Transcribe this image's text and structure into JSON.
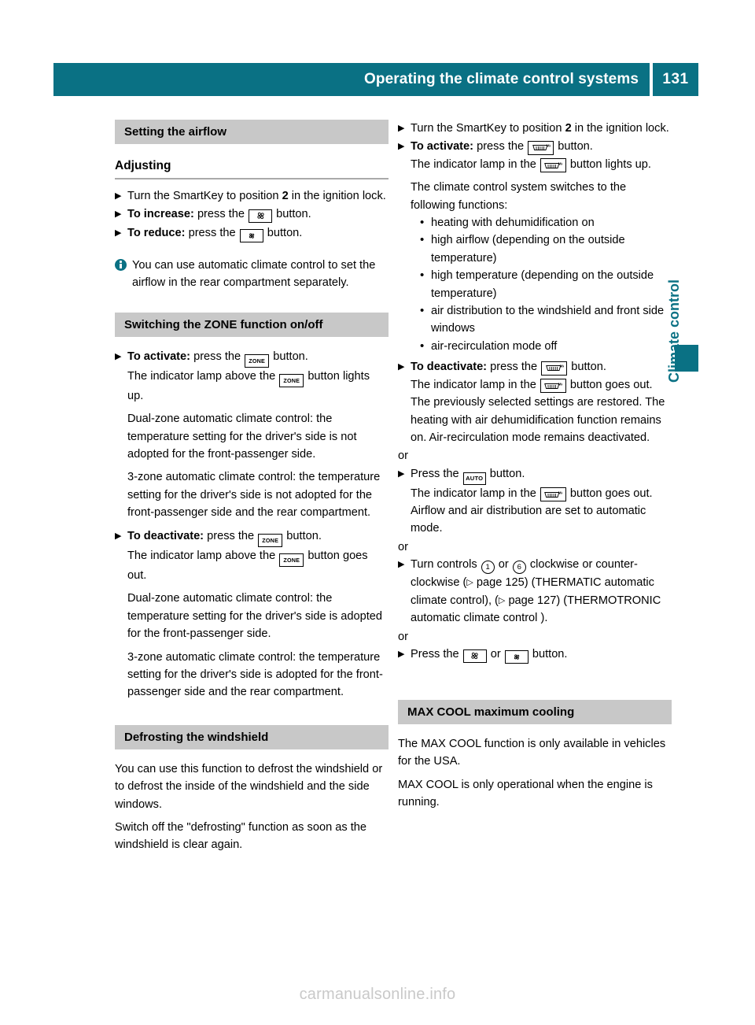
{
  "header": {
    "title": "Operating the climate control systems",
    "page_number": "131",
    "bar_color": "#0a7184"
  },
  "side_tab": {
    "label": "Climate control",
    "color": "#0a7184"
  },
  "watermark": "carmanualsonline.info",
  "icons": {
    "fan_big": "fan-high-icon",
    "fan_small": "fan-low-icon",
    "zone_label": "ZONE",
    "defrost_max_label": "MAX",
    "auto_label": "AUTO",
    "info": "info-icon",
    "ref_arrow": "▷",
    "step_marker": "▶",
    "round_bullet": "•"
  },
  "left_column": {
    "section1": {
      "band": "Setting the airflow",
      "subheading": "Adjusting",
      "steps": [
        {
          "bold": "",
          "text_before": "Turn the SmartKey to position ",
          "bold_inline": "2",
          "text_after": " in the ignition lock."
        },
        {
          "bold": "To increase:",
          "text_before": " press the ",
          "icon": "fan-high-icon",
          "text_after": " button."
        },
        {
          "bold": "To reduce:",
          "text_before": " press the ",
          "icon": "fan-low-icon",
          "text_after": " button."
        }
      ],
      "note": "You can use automatic climate control to set the airflow in the rear compartment separately."
    },
    "section2": {
      "band": "Switching the ZONE function on/off",
      "activate": {
        "bold": "To activate:",
        "text_before": " press the ",
        "icon_label": "ZONE",
        "text_after": " button.",
        "line2_a": "The indicator lamp above the ",
        "line2_b": " button lights up.",
        "para_dual": "Dual-zone automatic climate control: the temperature setting for the driver's side is not adopted for the front-passenger side.",
        "para_3zone": "3-zone automatic climate control: the temperature setting for the driver's side is not adopted for the front-passenger side and the rear compartment."
      },
      "deactivate": {
        "bold": "To deactivate:",
        "text_before": " press the ",
        "icon_label": "ZONE",
        "text_after": " button.",
        "line2_a": "The indicator lamp above the ",
        "line2_b": " button goes out.",
        "para_dual": "Dual-zone automatic climate control: the temperature setting for the driver's side is adopted for the front-passenger side.",
        "para_3zone": "3-zone automatic climate control: the temperature setting for the driver's side is adopted for the front-passenger side and the rear compartment."
      }
    },
    "section3": {
      "band": "Defrosting the windshield",
      "para1": "You can use this function to defrost the windshield or to defrost the inside of the windshield and the side windows.",
      "para2": "Switch off the \"defrosting\" function as soon as the windshield is clear again."
    }
  },
  "right_column": {
    "steps_top": {
      "step1_before": "Turn the SmartKey to position ",
      "step1_bold": "2",
      "step1_after": " in the ignition lock.",
      "activate_bold": "To activate:",
      "activate_before": " press the ",
      "activate_after": " button.",
      "activate_line2_a": "The indicator lamp in the ",
      "activate_line2_b": " button lights up.",
      "switches_text": "The climate control system switches to the following functions:",
      "functions": [
        "heating with dehumidification on",
        "high airflow (depending on the outside temperature)",
        "high temperature (depending on the outside temperature)",
        "air distribution to the windshield and front side windows",
        "air-recirculation mode off"
      ]
    },
    "deactivate": {
      "bold": "To deactivate:",
      "text_before": " press the ",
      "text_after": " button.",
      "line2_a": "The indicator lamp in the ",
      "line2_b": " button goes out. The previously selected settings are restored. The heating with air dehumidification function remains on. Air-recirculation mode remains deactivated."
    },
    "or_1": "or",
    "auto_step": {
      "text_before": "Press the ",
      "icon_label": "AUTO",
      "text_after": " button.",
      "line2_a": "The indicator lamp in the ",
      "line2_b": " button goes out. Airflow and air distribution are set to automatic mode."
    },
    "or_2": "or",
    "controls_step": {
      "text_a": "Turn controls ",
      "control_1": "1",
      "text_b": " or ",
      "control_2": "6",
      "text_c": " clockwise or counter-clockwise (",
      "ref_1": " page 125",
      "text_d": ") (THERMATIC automatic climate control), (",
      "ref_2": " page 127",
      "text_e": ") (THERMOTRONIC automatic climate control )."
    },
    "or_3": "or",
    "fan_step": {
      "text_before": "Press the ",
      "text_middle": " or ",
      "text_after": " button."
    },
    "max_cool": {
      "band": "MAX COOL maximum cooling",
      "para1": "The MAX COOL function is only available in vehicles for the USA.",
      "para2": "MAX COOL is only operational when the engine is running."
    }
  }
}
